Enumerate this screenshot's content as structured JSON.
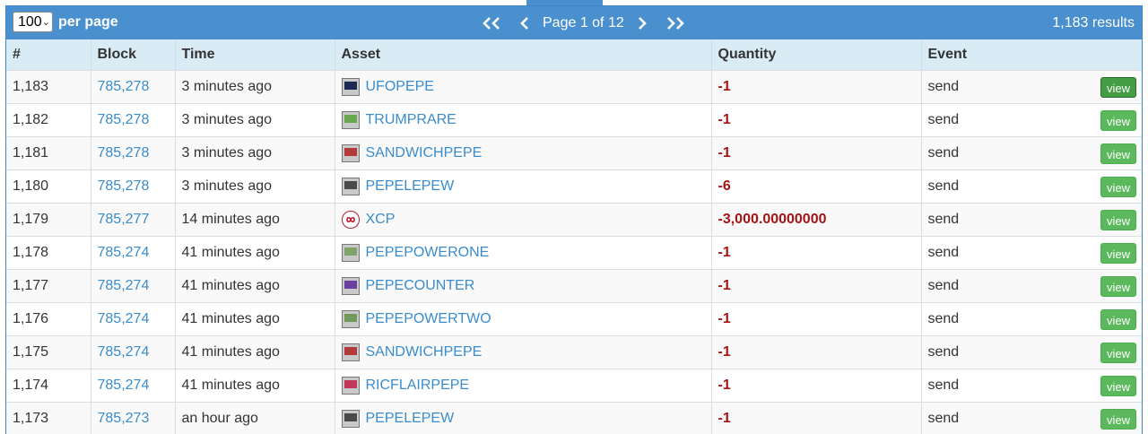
{
  "toolbar": {
    "per_page_value": "100",
    "per_page_label": "per page",
    "page_text": "Page 1 of 12",
    "results_text": "1,183 results"
  },
  "table": {
    "headers": [
      "#",
      "Block",
      "Time",
      "Asset",
      "Quantity",
      "Event"
    ],
    "view_label": "view",
    "rows": [
      {
        "num": "1,183",
        "block": "785,278",
        "time": "3 minutes ago",
        "asset": "UFOPEPE",
        "icon": "ufopepe-card-icon",
        "icon_color": "#1d2a52",
        "quantity": "-1",
        "event": "send"
      },
      {
        "num": "1,182",
        "block": "785,278",
        "time": "3 minutes ago",
        "asset": "TRUMPRARE",
        "icon": "trumprare-pepe-icon",
        "icon_color": "#6aa84f",
        "quantity": "-1",
        "event": "send"
      },
      {
        "num": "1,181",
        "block": "785,278",
        "time": "3 minutes ago",
        "asset": "SANDWICHPEPE",
        "icon": "sandwichpepe-card-icon",
        "icon_color": "#b33a3a",
        "quantity": "-1",
        "event": "send"
      },
      {
        "num": "1,180",
        "block": "785,278",
        "time": "3 minutes ago",
        "asset": "PEPELEPEW",
        "icon": "pepelepew-card-icon",
        "icon_color": "#4a4a4a",
        "quantity": "-6",
        "event": "send"
      },
      {
        "num": "1,179",
        "block": "785,277",
        "time": "14 minutes ago",
        "asset": "XCP",
        "icon": "xcp-logo-icon",
        "icon_color": "#b01c2e",
        "quantity": "-3,000.00000000",
        "event": "send"
      },
      {
        "num": "1,178",
        "block": "785,274",
        "time": "41 minutes ago",
        "asset": "PEPEPOWERONE",
        "icon": "pepepowerone-card-icon",
        "icon_color": "#7fa36b",
        "quantity": "-1",
        "event": "send"
      },
      {
        "num": "1,177",
        "block": "785,274",
        "time": "41 minutes ago",
        "asset": "PEPECOUNTER",
        "icon": "pepecounter-card-icon",
        "icon_color": "#6b3fa0",
        "quantity": "-1",
        "event": "send"
      },
      {
        "num": "1,176",
        "block": "785,274",
        "time": "41 minutes ago",
        "asset": "PEPEPOWERTWO",
        "icon": "pepepowertwo-card-icon",
        "icon_color": "#6f9a5a",
        "quantity": "-1",
        "event": "send"
      },
      {
        "num": "1,175",
        "block": "785,274",
        "time": "41 minutes ago",
        "asset": "SANDWICHPEPE",
        "icon": "sandwichpepe-card-icon",
        "icon_color": "#b33a3a",
        "quantity": "-1",
        "event": "send"
      },
      {
        "num": "1,174",
        "block": "785,274",
        "time": "41 minutes ago",
        "asset": "RICFLAIRPEPE",
        "icon": "ricflairpepe-card-icon",
        "icon_color": "#c0395a",
        "quantity": "-1",
        "event": "send"
      },
      {
        "num": "1,173",
        "block": "785,273",
        "time": "an hour ago",
        "asset": "PEPELEPEW",
        "icon": "pepelepew-card-icon",
        "icon_color": "#4a4a4a",
        "quantity": "-1",
        "event": "send"
      }
    ]
  },
  "colors": {
    "header_bar": "#4a90cf",
    "column_header_bg": "#d9ecf5",
    "link": "#3a8ccc",
    "quantity_negative": "#a31515",
    "view_button": "#5cb85c"
  }
}
